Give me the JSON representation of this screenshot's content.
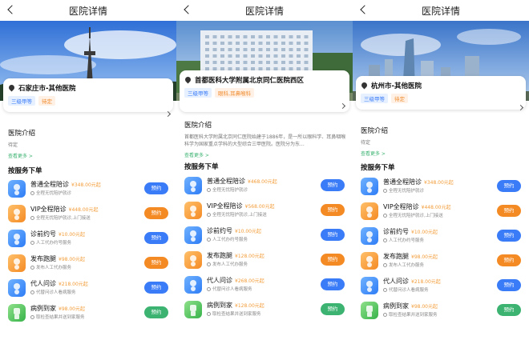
{
  "panels": [
    {
      "nav_title": "医院详情",
      "hospital_name": "石家庄市-其他医院",
      "tags": [
        "三级甲等",
        "待定"
      ],
      "intro_title": "医院介绍",
      "intro_text": "待定",
      "more_label": "查看更多 >",
      "section_title": "按服务下单",
      "services": [
        {
          "name": "普通全程陪诊",
          "price": "¥348.00元起",
          "desc": "全程无忧陪护就诊",
          "button": "预约",
          "color": "blue"
        },
        {
          "name": "VIP全程陪诊",
          "price": "¥448.00元起",
          "desc": "全程无忧陪护就诊,上门接送",
          "button": "预约",
          "color": "orange"
        },
        {
          "name": "诊前约号",
          "price": "¥10.00元起",
          "desc": "人工代办约号服务",
          "button": "预约",
          "color": "blue"
        },
        {
          "name": "发布跑腿",
          "price": "¥98.00元起",
          "desc": "发布人工代办服务",
          "button": "预约",
          "color": "orange"
        },
        {
          "name": "代人问诊",
          "price": "¥218.00元起",
          "desc": "代替问诊人看病服务",
          "button": "预约",
          "color": "blue"
        },
        {
          "name": "病例到家",
          "price": "¥98.00元起",
          "desc": "取检查结果并送到家服务",
          "button": "预约",
          "color": "green"
        }
      ]
    },
    {
      "nav_title": "医院详情",
      "hospital_name": "首都医科大学附属北京同仁医院西区",
      "tags": [
        "三级甲等",
        "眼科,耳鼻喉科"
      ],
      "intro_title": "医院介绍",
      "intro_text": "首都医科大学附属北京同仁医院始建于1886年，是一所以眼科学、耳鼻咽喉科学为国家重点学科的大型综合三甲医院。医院分为东...",
      "more_label": "查看更多 >",
      "section_title": "按服务下单",
      "services": [
        {
          "name": "普通全程陪诊",
          "price": "¥468.00元起",
          "desc": "全程无忧陪护就诊",
          "button": "预约",
          "color": "blue"
        },
        {
          "name": "VIP全程陪诊",
          "price": "¥568.00元起",
          "desc": "全程无忧陪护就诊,上门接送",
          "button": "预约",
          "color": "orange"
        },
        {
          "name": "诊前约号",
          "price": "¥10.00元起",
          "desc": "人工代办约号服务",
          "button": "预约",
          "color": "blue"
        },
        {
          "name": "发布跑腿",
          "price": "¥128.00元起",
          "desc": "发布人工代办服务",
          "button": "预约",
          "color": "orange"
        },
        {
          "name": "代人问诊",
          "price": "¥268.00元起",
          "desc": "代替问诊人看病服务",
          "button": "预约",
          "color": "blue"
        },
        {
          "name": "病例到家",
          "price": "¥128.00元起",
          "desc": "取检查结果并送到家服务",
          "button": "预约",
          "color": "green"
        }
      ]
    },
    {
      "nav_title": "医院详情",
      "hospital_name": "杭州市-其他医院",
      "tags": [
        "三级甲等",
        "待定"
      ],
      "intro_title": "医院介绍",
      "intro_text": "待定",
      "more_label": "查看更多 >",
      "section_title": "按服务下单",
      "services": [
        {
          "name": "普通全程陪诊",
          "price": "¥348.00元起",
          "desc": "全程无忧陪护就诊",
          "button": "预约",
          "color": "blue"
        },
        {
          "name": "VIP全程陪诊",
          "price": "¥448.00元起",
          "desc": "全程无忧陪护就诊,上门接送",
          "button": "预约",
          "color": "orange"
        },
        {
          "name": "诊前约号",
          "price": "¥10.00元起",
          "desc": "人工代办约号服务",
          "button": "预约",
          "color": "blue"
        },
        {
          "name": "发布跑腿",
          "price": "¥98.00元起",
          "desc": "发布人工代办服务",
          "button": "预约",
          "color": "orange"
        },
        {
          "name": "代人问诊",
          "price": "¥218.00元起",
          "desc": "代替问诊人看病服务",
          "button": "预约",
          "color": "blue"
        },
        {
          "name": "病例到家",
          "price": "¥98.00元起",
          "desc": "取检查结果并送到家服务",
          "button": "预约",
          "color": "green"
        }
      ]
    }
  ]
}
